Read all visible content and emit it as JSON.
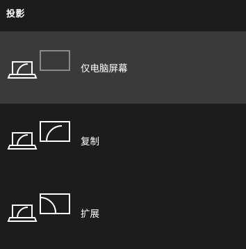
{
  "panel": {
    "title": "投影",
    "options": [
      {
        "id": "pc-screen-only",
        "label": "仅电脑屏幕",
        "selected": true,
        "icon": "pc-screen-only-icon"
      },
      {
        "id": "duplicate",
        "label": "复制",
        "selected": false,
        "icon": "duplicate-icon"
      },
      {
        "id": "extend",
        "label": "扩展",
        "selected": false,
        "icon": "extend-icon"
      }
    ]
  },
  "colors": {
    "background": "#1c1c1c",
    "selected_background": "#3a3a3a",
    "foreground": "#ffffff",
    "dim_monitor": "#8a8a8a"
  }
}
